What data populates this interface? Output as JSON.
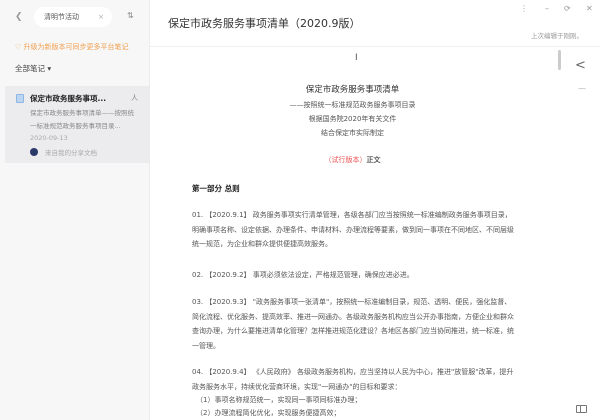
{
  "sidebar": {
    "search_value": "清明节活动",
    "notice": "升级为新版本可同步更多平台笔记",
    "filter_label": "全部笔记",
    "note": {
      "title": "保定市政务服务事项...",
      "pin": "人",
      "snippet": "保定市政务服务事项清单——按照统一标准规范政务服务事项目录...",
      "date": "2020-09-13",
      "author": "来自我的分享文档"
    }
  },
  "header": {
    "title": "保定市政务服务事项清单（2020.9版）",
    "saved": "上次编辑于刚刚。",
    "win": [
      "⋮",
      "–",
      "⟳",
      "✕"
    ]
  },
  "doc": {
    "title": "保定市政务服务事项清单",
    "sub1": "——按照统一标准规范政务服务事项目录",
    "sub2": "根据国务院2020年有关文件",
    "sub3": "结合保定市实际制定",
    "red": "（试行版本）",
    "red_after": "正文",
    "section": "第一部分 总则",
    "paras": [
      "01. 【2020.9.1】 政务服务事项实行清单管理，各级各部门应当按照统一标准编制政务服务事项目录，明确事项名称、设定依据、办理条件、申请材料、办理流程等要素，做到同一事项在不同地区、不同层级统一规范，为企业和群众提供便捷高效服务。",
      "02. 【2020.9.2】 事项必须依法设定，严格规范管理，确保应进必进。",
      "03. 【2020.9.3】 \"政务服务事项一张清单\"，按照统一标准编制目录，规范、透明、便民，强化监督、简化流程、优化服务、提高效率、推进一网通办。各级政务服务机构应当公开办事指南，方便企业和群众查询办理，为什么要推进清单化管理？怎样推进规范化建设？各地区各部门应当协同推进，统一标准，统一管理。",
      "04. 【2020.9.4】 《人民政府》 各级政务服务机构，应当坚持以人民为中心，推进\"放管服\"改革，提升政务服务水平，持续优化营商环境，实现\"一网通办\"的目标和要求："
    ],
    "items": [
      "（1）事项名称规范统一，实现同一事项同标准办理；",
      "（2）办理流程简化优化，实现服务便捷高效；"
    ]
  }
}
